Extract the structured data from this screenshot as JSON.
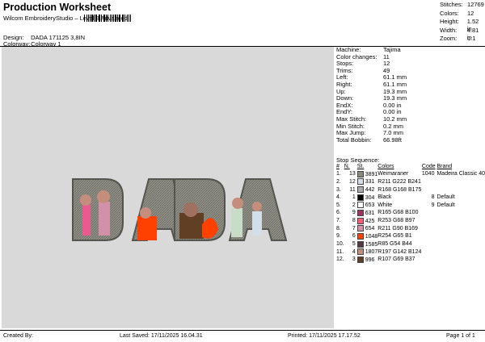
{
  "header": {
    "title": "Production Worksheet",
    "software": "Wilcom EmbroideryStudio – Level 3 Advanced",
    "design_label": "Design:",
    "design_value": "DADA 171125 3,8IN",
    "colorway_label": "Colorway:",
    "colorway_value": "Colorway 1"
  },
  "stats": [
    {
      "label": "Stitches:",
      "value": "12769"
    },
    {
      "label": "Colors:",
      "value": "12"
    },
    {
      "label": "Height:",
      "value": "1.52 in"
    },
    {
      "label": "Width:",
      "value": "4.81 in"
    },
    {
      "label": "Zoom:",
      "value": "1:1"
    }
  ],
  "machine_info": [
    {
      "label": "Machine:",
      "value": "Tajima"
    },
    {
      "label": "Color changes:",
      "value": "11"
    },
    {
      "label": "Stops:",
      "value": "12"
    },
    {
      "label": "Trims:",
      "value": "49"
    },
    {
      "label": "Left:",
      "value": "61.1 mm"
    },
    {
      "label": "Right:",
      "value": "61.1 mm"
    },
    {
      "label": "Up:",
      "value": "19.3 mm"
    },
    {
      "label": "Down:",
      "value": "19.3 mm"
    },
    {
      "label": "EndX:",
      "value": "0.00 in"
    },
    {
      "label": "EndY:",
      "value": "0.00 in"
    },
    {
      "label": "Max Stitch:",
      "value": "10.2 mm"
    },
    {
      "label": "Min Stitch:",
      "value": "0.2 mm"
    },
    {
      "label": "Max Jump:",
      "value": "7.0 mm"
    },
    {
      "label": "Total Bobbin:",
      "value": "66.98ft"
    }
  ],
  "stop_sequence": {
    "title": "Stop Sequence:",
    "headers": {
      "hash": "#",
      "n": "N.",
      "st": "St.",
      "colors": "Colors",
      "code": "Code",
      "brand": "Brand"
    },
    "rows": [
      {
        "n": "1.",
        "st": "13",
        "color": "#8a8a7a",
        "code": "3891",
        "name": "Weimaraner",
        "thread": "1040",
        "brand": "Madeira Classic 40"
      },
      {
        "n": "2.",
        "st": "12",
        "color": "#d2dee8",
        "code": "331",
        "name": "R211 G222 B241",
        "thread": "",
        "brand": ""
      },
      {
        "n": "3.",
        "st": "11",
        "color": "#a8a8af",
        "code": "442",
        "name": "R168 G168 B175",
        "thread": "",
        "brand": ""
      },
      {
        "n": "4.",
        "st": "1",
        "color": "#000000",
        "code": "304",
        "name": "Black",
        "thread": "8",
        "brand": "Default"
      },
      {
        "n": "5.",
        "st": "2",
        "color": "#ffffff",
        "code": "653",
        "name": "White",
        "thread": "9",
        "brand": "Default"
      },
      {
        "n": "6.",
        "st": "9",
        "color": "#a5305f",
        "code": "631",
        "name": "R165 G68 B100",
        "thread": "",
        "brand": ""
      },
      {
        "n": "7.",
        "st": "8",
        "color": "#fd5b6f",
        "code": "425",
        "name": "R253 G68 B97",
        "thread": "",
        "brand": ""
      },
      {
        "n": "8.",
        "st": "7",
        "color": "#d290a9",
        "code": "654",
        "name": "R211 G90 B169",
        "thread": "",
        "brand": ""
      },
      {
        "n": "9.",
        "st": "6",
        "color": "#fe4101",
        "code": "1048",
        "name": "R254 G65 B1",
        "thread": "",
        "brand": ""
      },
      {
        "n": "10.",
        "st": "5",
        "color": "#553644",
        "code": "1585",
        "name": "R85 G54 B44",
        "thread": "",
        "brand": ""
      },
      {
        "n": "11.",
        "st": "4",
        "color": "#c58e7c",
        "code": "1807",
        "name": "R197 G142 B124",
        "thread": "",
        "brand": ""
      },
      {
        "n": "12.",
        "st": "3",
        "color": "#603f25",
        "code": "996",
        "name": "R107 G69 B37",
        "thread": "",
        "brand": ""
      }
    ]
  },
  "footer": {
    "created": "Created By:",
    "last_saved": "Last Saved: 17/11/2025 16.04.31",
    "printed": "Printed: 17/11/2025 17.17.52",
    "page": "Page 1 of 1"
  }
}
